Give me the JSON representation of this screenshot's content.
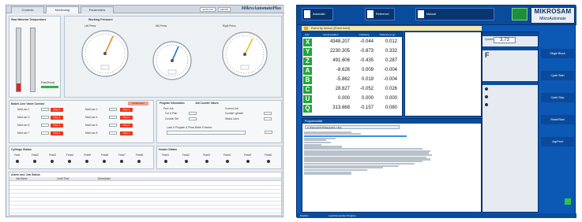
{
  "left_screen": {
    "tabs": [
      "Controls",
      "Monitoring",
      "Parameters"
    ],
    "active_tab": "Monitoring",
    "header_pills": [
      "AUTO ON",
      "ESTOP"
    ],
    "brand": "MikroAutomatePlus",
    "temp_panel_title": "Raw Material Temperature",
    "gauges_title": "Working Pressure",
    "gauges": [
      {
        "title": "Left Press"
      },
      {
        "title": "Mid Press"
      },
      {
        "title": "Right Press"
      }
    ],
    "left_status": "Pass/Ready",
    "valves_title": "Batch Line Valve Control",
    "valve_button": "Parameters",
    "valve_labels": [
      "Mold cav 1",
      "Mold cav 2",
      "Mold cav 3",
      "Mold cav 4",
      "Mold cav 5",
      "Mold cav 6",
      "Mold cav 7",
      "Mold cav 8"
    ],
    "valve_state": "Stop 1 Valve",
    "program_tabs": [
      "Program Information",
      "Job Counter Values"
    ],
    "program_fields": [
      "Prev Job",
      "Cut & Plan",
      "Counter Set",
      "Current Job",
      "Counter cylinder",
      "Status Lines"
    ],
    "load_program": "Load & Program & Press Batch Function",
    "cyl_title": "Cyllinge Status",
    "cyl_labels": [
      "Feed",
      "Feed2",
      "Feed3",
      "Feed4",
      "Feed5",
      "Feed6",
      "Feed7",
      "Feed8"
    ],
    "heater_title": "Heater Status",
    "heater_labels": [
      "Feed1",
      "Feed2",
      "Feed3",
      "Feed4",
      "Feed5",
      "Feed6"
    ],
    "alarm_title": "Alarm and Job Status",
    "alarm_cols": [
      "Job Name",
      "Code Time",
      "Description"
    ]
  },
  "right_screen": {
    "brand": "MIKROSAM",
    "brand_sub": "MikroAutomate",
    "toolbar": [
      "Automatic",
      "Reference",
      "Manual"
    ],
    "alert": "Event by sensor (Event bard)",
    "coord_cols": [
      "Axis",
      "Actual position",
      "Following",
      "Distance to go"
    ],
    "axes": [
      {
        "name": "X",
        "v1": "4348.207",
        "v2": "-0.044",
        "v3": "0.012"
      },
      {
        "name": "Y",
        "v1": "2230.305",
        "v2": "-0.873",
        "v3": "0.332"
      },
      {
        "name": "Z",
        "v1": "491.606",
        "v2": "-0.435",
        "v3": "0.287"
      },
      {
        "name": "A",
        "v1": "-8.626",
        "v2": "0.009",
        "v3": "-0.004"
      },
      {
        "name": "B",
        "v1": "-5.862",
        "v2": "0.019",
        "v3": "-0.004"
      },
      {
        "name": "C",
        "v1": "28.827",
        "v2": "-0.052",
        "v3": "0.026"
      },
      {
        "name": "U",
        "v1": "0.000",
        "v2": "0.000",
        "v3": "0.000"
      },
      {
        "name": "Q",
        "v1": "313.668",
        "v2": "-0.157",
        "v3": "0.080"
      }
    ],
    "prog_title": "Programmable",
    "prog_file": "C:\\Parts\\147070\\Saved\\15 7-tbls",
    "spindle_label": "Spindle",
    "spindle_value": "3.73",
    "feed_label": "Feed",
    "feed_value": "F",
    "side_buttons": [
      "Single Block",
      "Cycle Start",
      "Cycle Stop",
      "Reset/Start",
      "Jog/Feed"
    ],
    "status_left": "Position",
    "status_right": "Load Remember Program"
  }
}
